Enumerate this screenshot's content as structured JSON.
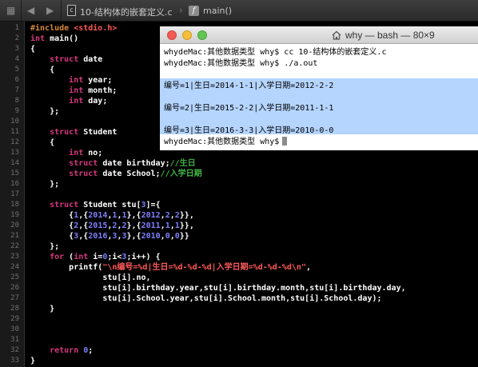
{
  "navbar": {
    "back_glyph": "◀",
    "forward_glyph": "▶",
    "file_icon_letter": "c",
    "file_name": "10-结构体的嵌套定义.c",
    "function_icon_letter": "f",
    "function_name": "main()",
    "icons": [
      "back-arrow-icon",
      "forward-arrow-icon",
      "grid-icon",
      "c-file-icon",
      "function-icon"
    ]
  },
  "editor": {
    "line_numbers": [
      "1",
      "2",
      "3",
      "4",
      "5",
      "6",
      "7",
      "8",
      "9",
      "10",
      "11",
      "12",
      "13",
      "14",
      "15",
      "16",
      "17",
      "18",
      "19",
      "20",
      "21",
      "22",
      "23",
      "24",
      "25",
      "26",
      "27",
      "28",
      "29",
      "30",
      "31",
      "32",
      "33"
    ],
    "colors": {
      "keyword": "#d7377f",
      "string": "#ff5959",
      "number": "#7f7fff",
      "preprocessor": "#d98a3a",
      "comment": "#41b645"
    }
  },
  "code": {
    "l1_include": "#include",
    "l1_header": "<stdio.h>",
    "l2_type": "int",
    "l2_rest": " main()",
    "l3": "{",
    "l4_kw": "struct",
    "l4_rest": " date",
    "l5": "{",
    "l6_kw": "int",
    "l6_rest": " year;",
    "l7_kw": "int",
    "l7_rest": " month;",
    "l8_kw": "int",
    "l8_rest": " day;",
    "l9": "};",
    "l11_kw": "struct",
    "l11_rest": " Student",
    "l12": "{",
    "l13_kw": "int",
    "l13_rest": " no;",
    "l14_kw": "struct",
    "l14_rest": " date birthday;",
    "l14_comment": "//生日",
    "l15_kw": "struct",
    "l15_rest": " date School;",
    "l15_comment": "//入学日期",
    "l16": "};",
    "l18_kw": "struct",
    "l18_rest": " Student stu[",
    "l18_num": "3",
    "l18_end": "]={",
    "l19_a": "{",
    "l19_n1": "1",
    "l19_b": ",{",
    "l19_n2": "2014",
    "l19_c": ",",
    "l19_n3": "1",
    "l19_d": ",",
    "l19_n4": "1",
    "l19_e": "},{",
    "l19_n5": "2012",
    "l19_f": ",",
    "l19_n6": "2",
    "l19_g": ",",
    "l19_n7": "2",
    "l19_h": "}},",
    "l20_a": "{",
    "l20_n1": "2",
    "l20_b": ",{",
    "l20_n2": "2015",
    "l20_c": ",",
    "l20_n3": "2",
    "l20_d": ",",
    "l20_n4": "2",
    "l20_e": "},{",
    "l20_n5": "2011",
    "l20_f": ",",
    "l20_n6": "1",
    "l20_g": ",",
    "l20_n7": "1",
    "l20_h": "}},",
    "l21_a": "{",
    "l21_n1": "3",
    "l21_b": ",{",
    "l21_n2": "2016",
    "l21_c": ",",
    "l21_n3": "3",
    "l21_d": ",",
    "l21_n4": "3",
    "l21_e": "},{",
    "l21_n5": "2010",
    "l21_f": ",",
    "l21_n6": "0",
    "l21_g": ",",
    "l21_n7": "0",
    "l21_h": "}}",
    "l22": "};",
    "l23_kw": "for",
    "l23_a": " (",
    "l23_kw2": "int",
    "l23_b": " i=",
    "l23_n1": "0",
    "l23_c": ";i<",
    "l23_n2": "3",
    "l23_d": ";i++) {",
    "l24_fn": "printf(",
    "l24_str": "\"\\n编号=%d|生日=%d-%d-%d|入学日期=%d-%d-%d\\n\"",
    "l24_end": ",",
    "l25": "stu[i].no,",
    "l26": "stu[i].birthday.year,stu[i].birthday.month,stu[i].birthday.day,",
    "l27": "stu[i].School.year,stu[i].School.month,stu[i].School.day);",
    "l28": "}",
    "l32_kw": "return",
    "l32_num": "0",
    "l32_end": ";",
    "l33": "}"
  },
  "terminal": {
    "title": "why — bash — 80×9",
    "lines": [
      "whydeMac:其他数据类型 why$ cc 10-结构体的嵌套定义.c",
      "whydeMac:其他数据类型 why$ ./a.out",
      "",
      "编号=1|生日=2014-1-1|入学日期=2012-2-2",
      "",
      "编号=2|生日=2015-2-2|入学日期=2011-1-1",
      "",
      "编号=3|生日=2016-3-3|入学日期=2010-0-0",
      "whydeMac:其他数据类型 why$"
    ],
    "selection_color": "#b5d5ff"
  }
}
